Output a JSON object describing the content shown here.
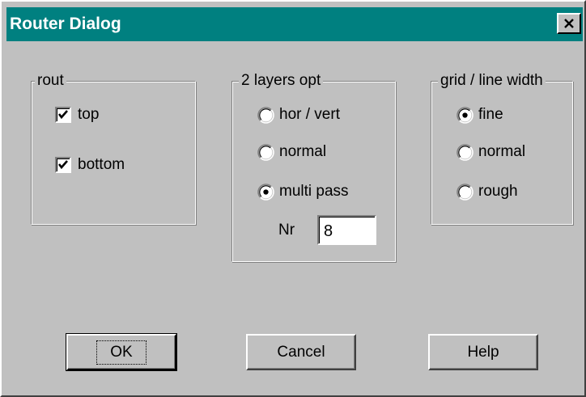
{
  "window": {
    "title": "Router Dialog"
  },
  "rout": {
    "label": "rout",
    "top": {
      "label": "top",
      "checked": true
    },
    "bottom": {
      "label": "bottom",
      "checked": true
    }
  },
  "layers": {
    "label": "2 layers opt",
    "options": [
      {
        "label": "hor / vert",
        "selected": false
      },
      {
        "label": "normal",
        "selected": false
      },
      {
        "label": "multi pass",
        "selected": true
      }
    ],
    "nr_label": "Nr",
    "nr_value": "8"
  },
  "grid": {
    "label": "grid / line width",
    "options": [
      {
        "label": "fine",
        "selected": true
      },
      {
        "label": "normal",
        "selected": false
      },
      {
        "label": "rough",
        "selected": false
      }
    ]
  },
  "buttons": {
    "ok": "OK",
    "cancel": "Cancel",
    "help": "Help"
  },
  "colors": {
    "titlebar": "#008080",
    "face": "#c0c0c0"
  }
}
